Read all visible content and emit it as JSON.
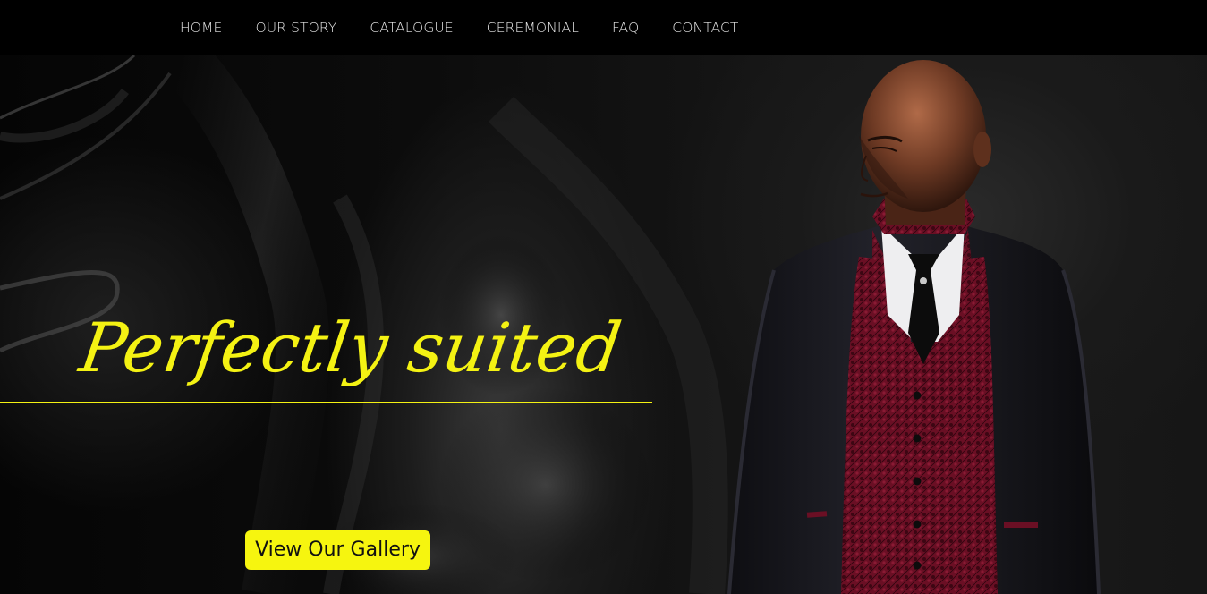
{
  "nav": {
    "items": [
      {
        "label": "HOME"
      },
      {
        "label": "OUR STORY"
      },
      {
        "label": "CATALOGUE"
      },
      {
        "label": "CEREMONIAL"
      },
      {
        "label": "FAQ"
      },
      {
        "label": "CONTACT"
      }
    ]
  },
  "hero": {
    "headline": "Perfectly suited",
    "cta_label": "View Our Gallery",
    "image_subject": "man-in-black-suit-burgundy-waistcoat"
  },
  "colors": {
    "accent": "#f4f213",
    "nav_bg": "#000000",
    "nav_text": "#e6e6e6",
    "suit": "#141418",
    "waistcoat": "#6a0f24",
    "skin": "#5a2e1e"
  }
}
